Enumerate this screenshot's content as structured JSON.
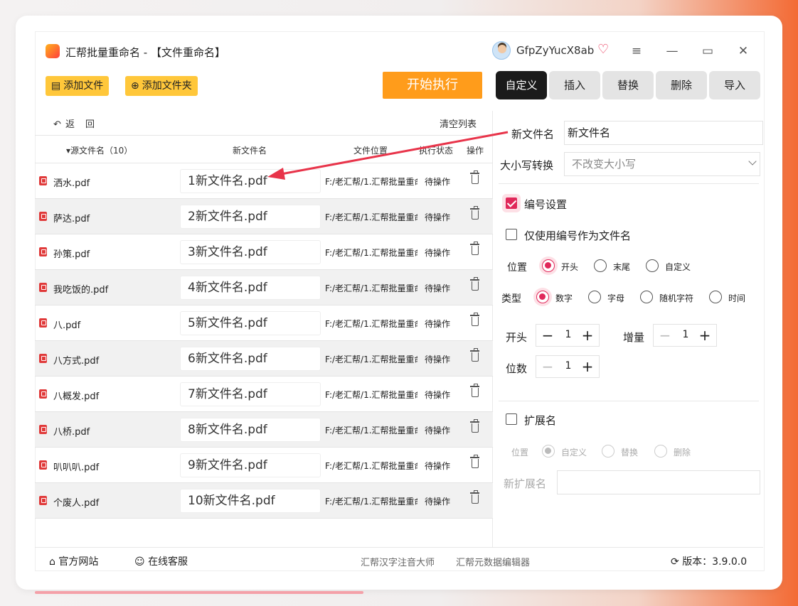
{
  "app": {
    "title": "汇帮批量重命名 - 【文件重命名】",
    "username": "GfpZyYucX8ab"
  },
  "toolbar": {
    "add_file": "添加文件",
    "add_folder": "添加文件夹",
    "start": "开始执行"
  },
  "tabs": [
    {
      "label": "自定义",
      "active": true
    },
    {
      "label": "插入"
    },
    {
      "label": "替换"
    },
    {
      "label": "删除"
    },
    {
      "label": "导入"
    }
  ],
  "list": {
    "back": "返　回",
    "clear": "清空列表",
    "headers": {
      "source": "▾源文件名（10）",
      "new_name": "新文件名",
      "location": "文件位置",
      "status": "执行状态",
      "action": "操作"
    },
    "rows": [
      {
        "source": "洒水.pdf",
        "new_name": "1新文件名.pdf",
        "path": "F:/老汇帮/1.汇帮批量重命",
        "status": "待操作"
      },
      {
        "source": "萨达.pdf",
        "new_name": "2新文件名.pdf",
        "path": "F:/老汇帮/1.汇帮批量重命",
        "status": "待操作"
      },
      {
        "source": "孙策.pdf",
        "new_name": "3新文件名.pdf",
        "path": "F:/老汇帮/1.汇帮批量重命",
        "status": "待操作"
      },
      {
        "source": "我吃饭的.pdf",
        "new_name": "4新文件名.pdf",
        "path": "F:/老汇帮/1.汇帮批量重命",
        "status": "待操作"
      },
      {
        "source": "八.pdf",
        "new_name": "5新文件名.pdf",
        "path": "F:/老汇帮/1.汇帮批量重命",
        "status": "待操作"
      },
      {
        "source": "八方式.pdf",
        "new_name": "6新文件名.pdf",
        "path": "F:/老汇帮/1.汇帮批量重命",
        "status": "待操作"
      },
      {
        "source": "八概发.pdf",
        "new_name": "7新文件名.pdf",
        "path": "F:/老汇帮/1.汇帮批量重命",
        "status": "待操作"
      },
      {
        "source": "八桥.pdf",
        "new_name": "8新文件名.pdf",
        "path": "F:/老汇帮/1.汇帮批量重命",
        "status": "待操作"
      },
      {
        "source": "叭叭叭.pdf",
        "new_name": "9新文件名.pdf",
        "path": "F:/老汇帮/1.汇帮批量重命",
        "status": "待操作"
      },
      {
        "source": "个废人.pdf",
        "new_name": "10新文件名.pdf",
        "path": "F:/老汇帮/1.汇帮批量重命",
        "status": "待操作"
      }
    ]
  },
  "settings": {
    "new_name_label": "新文件名",
    "new_name_value": "新文件名",
    "case_label": "大小写转换",
    "case_value": "不改变大小写",
    "numbering_label": "编号设置",
    "numbering_checked": true,
    "only_number_label": "仅使用编号作为文件名",
    "position_label": "位置",
    "position_options": [
      "开头",
      "末尾",
      "自定义"
    ],
    "type_label": "类型",
    "type_options": [
      "数字",
      "字母",
      "随机字符",
      "时间"
    ],
    "start_label": "开头",
    "start_value": "1",
    "increment_label": "增量",
    "increment_value": "1",
    "digits_label": "位数",
    "digits_value": "1",
    "ext_label": "扩展名",
    "ext_position_label": "位置",
    "ext_options": [
      "自定义",
      "替换",
      "删除"
    ],
    "new_ext_label": "新扩展名"
  },
  "footer": {
    "website": "官方网站",
    "support": "在线客服",
    "link1": "汇帮汉字注音大师",
    "link2": "汇帮元数据编辑器",
    "version": "版本：3.9.0.0"
  },
  "colors": {
    "accent": "#e0285a",
    "start": "#ff9c1b",
    "toolbar": "#ffc73a",
    "arrow": "#e8344a"
  }
}
